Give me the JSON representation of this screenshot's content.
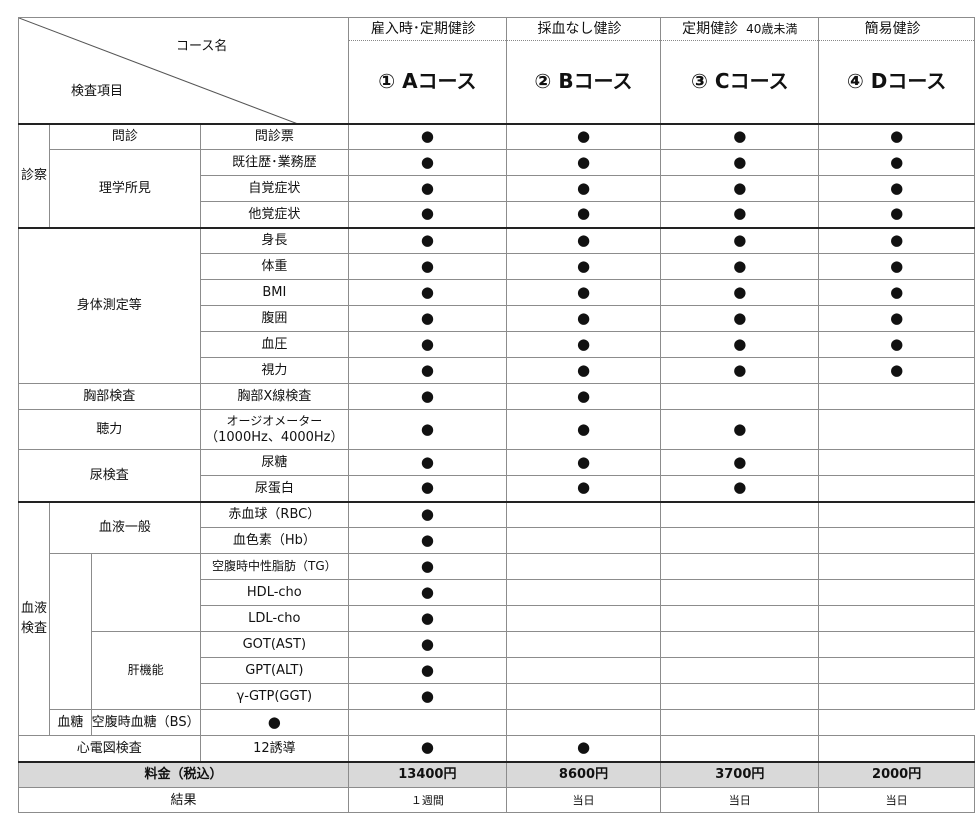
{
  "header": {
    "corner_course": "コース名",
    "corner_item": "検査項目",
    "courses": [
      {
        "sub": "雇入時･定期健診",
        "sub_small": "",
        "name": "①  Aコース"
      },
      {
        "sub": "採血なし健診",
        "sub_small": "",
        "name": "②  Bコース"
      },
      {
        "sub": "定期健診",
        "sub_small": "40歳未満",
        "name": "③  Cコース"
      },
      {
        "sub": "簡易健診",
        "sub_small": "",
        "name": "④  Dコース"
      }
    ]
  },
  "mark": "●",
  "groups": {
    "shinsatsu": "診察",
    "monshin": "問診",
    "rigaku": "理学所見",
    "shintai": "身体測定等",
    "kyobu": "胸部検査",
    "choryoku": "聴力",
    "nyo": "尿検査",
    "ketsueki": "血液検査",
    "ippan": "血液一般",
    "kankinou": "肝機能",
    "kettou": "血糖",
    "shindenzu": "心電図検査"
  },
  "rows": [
    {
      "item": "問診票",
      "marks": [
        true,
        true,
        true,
        true
      ]
    },
    {
      "item": "既往歴･業務歴",
      "marks": [
        true,
        true,
        true,
        true
      ]
    },
    {
      "item": "自覚症状",
      "marks": [
        true,
        true,
        true,
        true
      ]
    },
    {
      "item": "他覚症状",
      "marks": [
        true,
        true,
        true,
        true
      ]
    },
    {
      "item": "身長",
      "marks": [
        true,
        true,
        true,
        true
      ]
    },
    {
      "item": "体重",
      "marks": [
        true,
        true,
        true,
        true
      ]
    },
    {
      "item": "BMI",
      "marks": [
        true,
        true,
        true,
        true
      ]
    },
    {
      "item": "腹囲",
      "marks": [
        true,
        true,
        true,
        true
      ]
    },
    {
      "item": "血圧",
      "marks": [
        true,
        true,
        true,
        true
      ]
    },
    {
      "item": "視力",
      "marks": [
        true,
        true,
        true,
        true
      ]
    },
    {
      "item": "胸部X線検査",
      "marks": [
        true,
        true,
        false,
        false
      ]
    },
    {
      "item": "オージオメーター",
      "item2": "（1000Hz、4000Hz）",
      "marks": [
        true,
        true,
        true,
        false
      ]
    },
    {
      "item": "尿糖",
      "marks": [
        true,
        true,
        true,
        false
      ]
    },
    {
      "item": "尿蛋白",
      "marks": [
        true,
        true,
        true,
        false
      ]
    },
    {
      "item": "赤血球（RBC）",
      "marks": [
        true,
        false,
        false,
        false
      ]
    },
    {
      "item": "血色素（Hb）",
      "marks": [
        true,
        false,
        false,
        false
      ]
    },
    {
      "item": "空腹時中性脂肪（TG）",
      "marks": [
        true,
        false,
        false,
        false
      ]
    },
    {
      "item": "HDL-cho",
      "marks": [
        true,
        false,
        false,
        false
      ]
    },
    {
      "item": "LDL-cho",
      "marks": [
        true,
        false,
        false,
        false
      ]
    },
    {
      "item": "GOT(AST)",
      "marks": [
        true,
        false,
        false,
        false
      ]
    },
    {
      "item": "GPT(ALT)",
      "marks": [
        true,
        false,
        false,
        false
      ]
    },
    {
      "item": "γ-GTP(GGT)",
      "marks": [
        true,
        false,
        false,
        false
      ]
    },
    {
      "item": "空腹時血糖（BS）",
      "marks": [
        true,
        false,
        false,
        false
      ]
    },
    {
      "item": "12誘導",
      "marks": [
        true,
        true,
        false,
        false
      ]
    }
  ],
  "price": {
    "label": "料金（税込）",
    "values": [
      "13400円",
      "8600円",
      "3700円",
      "2000円"
    ]
  },
  "result": {
    "label": "結果",
    "values": [
      "１週間",
      "当日",
      "当日",
      "当日"
    ]
  }
}
